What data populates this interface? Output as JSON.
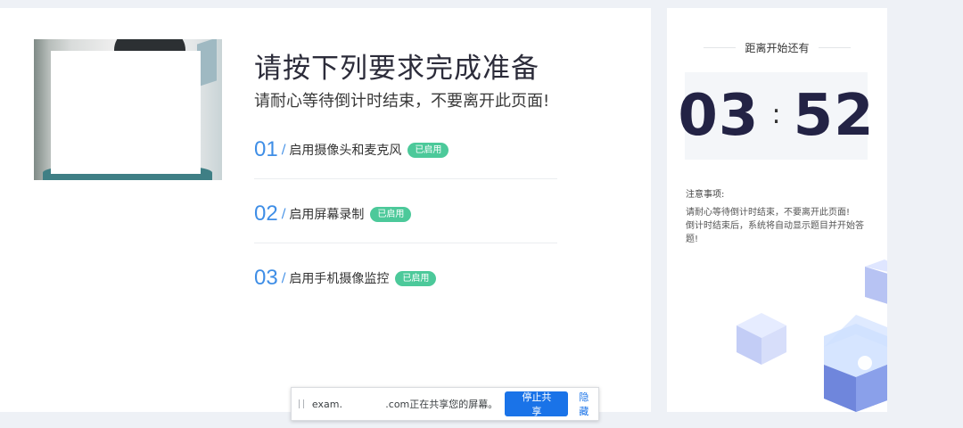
{
  "prep": {
    "title": "请按下列要求完成准备",
    "subtitle": "请耐心等待倒计时结束，不要离开此页面!",
    "steps": [
      {
        "num": "01",
        "sep": "/",
        "label": "启用摄像头和麦克风",
        "badge": "已启用"
      },
      {
        "num": "02",
        "sep": "/",
        "label": "启用屏幕录制",
        "badge": "已启用"
      },
      {
        "num": "03",
        "sep": "/",
        "label": "启用手机摄像监控",
        "badge": "已启用"
      }
    ]
  },
  "countdown": {
    "heading": "距离开始还有",
    "minutes": "03",
    "colon": ":",
    "seconds": "52",
    "notes_title": "注意事项:",
    "notes_line1": "请耐心等待倒计时结束，不要离开此页面!",
    "notes_line2": "倒计时结束后，系统将自动显示题目并开始答题!"
  },
  "share_bar": {
    "domain": "exam.",
    "message": ".com正在共享您的屏幕。",
    "stop_label": "停止共享",
    "hide_label": "隐藏"
  },
  "colors": {
    "accent_blue": "#3f8ee6",
    "badge_green": "#4cc99a",
    "countdown_text": "#232345",
    "share_button": "#1a73e8"
  }
}
